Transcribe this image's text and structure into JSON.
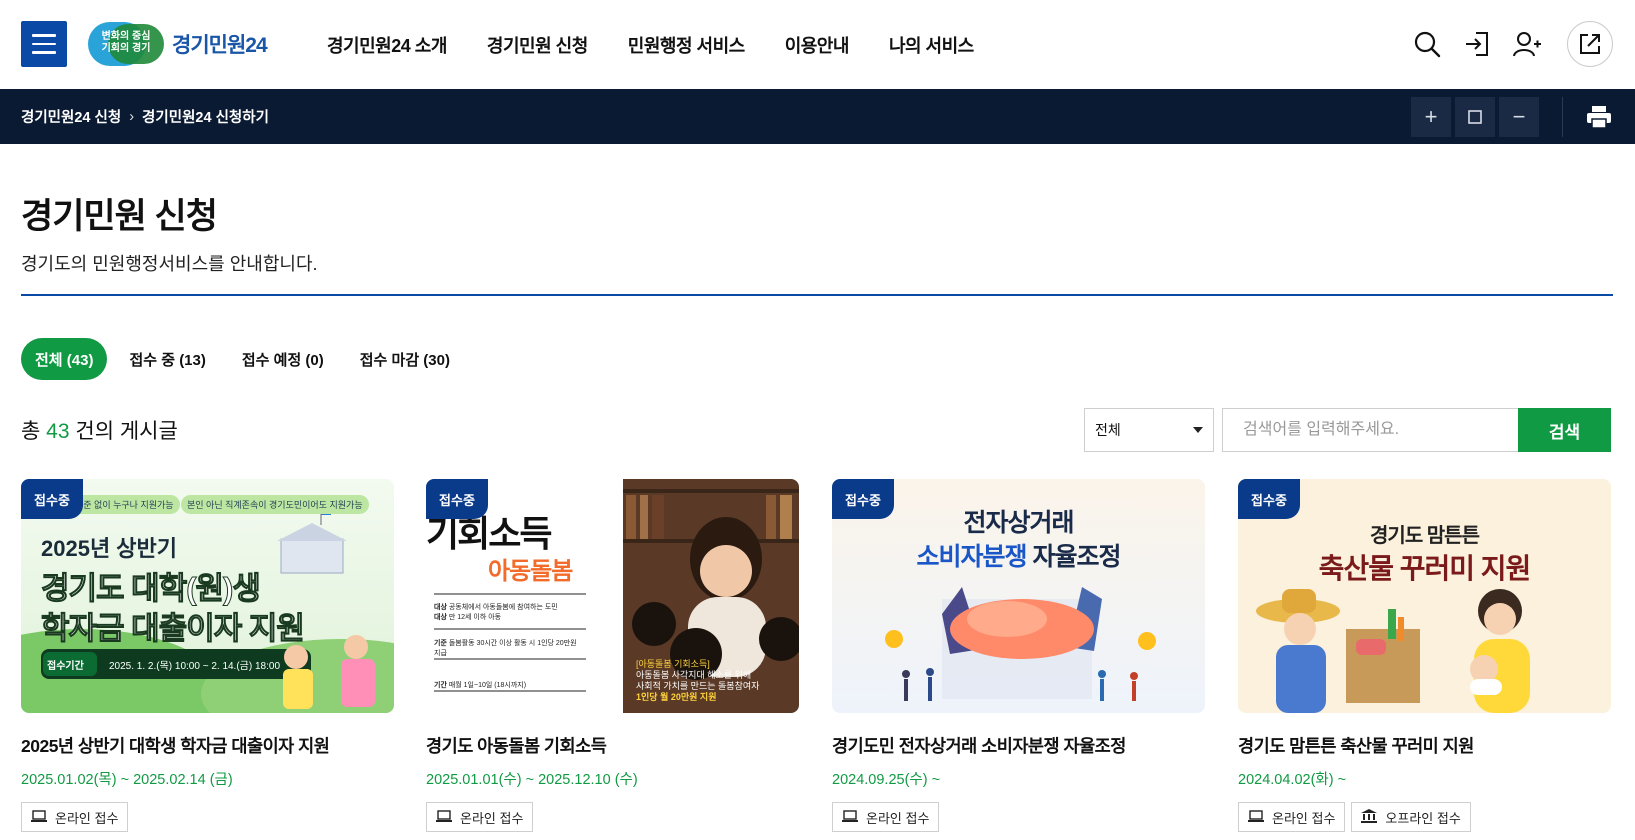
{
  "header": {
    "logo_badge": "변화의 중심\n기회의 경기",
    "logo_text": "경기민원24",
    "nav": [
      "경기민원24 소개",
      "경기민원 신청",
      "민원행정 서비스",
      "이용안내",
      "나의 서비스"
    ],
    "icons": [
      "search-icon",
      "login-icon",
      "signup-icon",
      "share-icon"
    ]
  },
  "breadcrumb": {
    "items": [
      "경기민원24 신청",
      "경기민원24 신청하기"
    ],
    "zoom_controls": [
      "+",
      "□",
      "−"
    ],
    "print_icon": "printer-icon"
  },
  "page": {
    "title": "경기민원 신청",
    "description": "경기도의 민원행정서비스를 안내합니다."
  },
  "tabs": [
    {
      "label": "전체 (43)",
      "active": true
    },
    {
      "label": "접수 중 (13)",
      "active": false
    },
    {
      "label": "접수 예정 (0)",
      "active": false
    },
    {
      "label": "접수 마감 (30)",
      "active": false
    }
  ],
  "list": {
    "total_prefix": "총",
    "total_count": "43",
    "total_suffix": "건의 게시글",
    "filter_value": "전체",
    "search_placeholder": "검색어를 입력해주세요.",
    "search_button": "검색"
  },
  "cards": [
    {
      "badge": "접수중",
      "title": "2025년 상반기 대학생 학자금 대출이자 지원",
      "date": "2025.01.02(목) ~ 2025.02.14 (금)",
      "tags": [
        "온라인 접수"
      ],
      "thumb": {
        "chip1": "기준 없이 누구나 지원가능",
        "chip2": "본인 아닌 직계존속이 경기도민이어도 지원가능",
        "line1": "2025년 상반기",
        "line2": "경기도 대학(원)생",
        "line3": "학자금 대출이자 지원",
        "period_label": "접수기간",
        "period": "2025. 1. 2.(목) 10:00 ~ 2. 14.(금) 18:00"
      }
    },
    {
      "badge": "접수중",
      "title": "경기도 아동돌봄 기회소득",
      "date": "2025.01.01(수) ~ 2025.12.10 (수)",
      "tags": [
        "온라인 접수"
      ],
      "thumb": {
        "head": "기회소득",
        "sub": "아동돌봄",
        "rows": [
          {
            "k": "대상",
            "v": "공동체에서 아동돌봄에 참여하는 도민"
          },
          {
            "k": "대상",
            "v": "만 12세 이하 아동"
          },
          {
            "k": "기준",
            "v": "돌봄활동 30시간 이상 활동 시 1인당 20만원 지급"
          },
          {
            "k": "기간",
            "v": "매월 1일~10일 (18시까지)"
          }
        ],
        "yellow": "[아동돌봄 기회소득]",
        "caption1": "아동돌봄 사각지대 해소를 위해",
        "caption2": "사회적 가치를 만드는 돌봄참여자",
        "caption3": "1인당 월 20만원 지원"
      }
    },
    {
      "badge": "접수중",
      "title": "경기도민 전자상거래 소비자분쟁 자율조정",
      "date": "2024.09.25(수) ~",
      "tags": [
        "온라인 접수"
      ],
      "thumb": {
        "line1": "전자상거래",
        "line2a": "소비자분쟁",
        "line2b": "자율조정"
      }
    },
    {
      "badge": "접수중",
      "title": "경기도 맘튼튼 축산물 꾸러미 지원",
      "date": "2024.04.02(화) ~",
      "tags": [
        "온라인 접수",
        "오프라인 접수"
      ],
      "thumb": {
        "line1": "경기도 맘튼튼",
        "line2": "축산물 꾸러미 지원"
      }
    }
  ],
  "colors": {
    "brand_blue": "#0a4aa6",
    "dark_bar": "#0a1a33",
    "accent_green": "#119a44",
    "badge_blue": "#0a3a8a"
  }
}
